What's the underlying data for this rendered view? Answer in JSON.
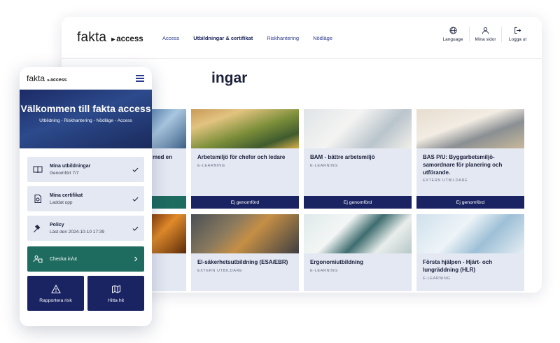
{
  "desktop": {
    "brand": {
      "name": "fakta",
      "product": "access"
    },
    "nav": [
      "Access",
      "Utbildningar & certifikat",
      "Riskhantering",
      "Nödläge"
    ],
    "tools": [
      {
        "label": "Language",
        "icon": "globe-icon"
      },
      {
        "label": "Mina sidor",
        "icon": "user-icon"
      },
      {
        "label": "Logga ut",
        "icon": "logout-icon"
      }
    ],
    "page_title": "ingar",
    "cards": [
      {
        "title": "med en",
        "type": "",
        "status": "",
        "image": "glass-building"
      },
      {
        "title": "Arbetsmiljö för chefer och ledare",
        "type": "E-LEARNING",
        "status": "Ej genomförd",
        "image": "construction-workers"
      },
      {
        "title": "BAM - bättre arbetsmiljö",
        "type": "E-LEARNING",
        "status": "Ej genomförd",
        "image": "office-desk"
      },
      {
        "title": "BAS P/U: Byggarbetsmiljö-samordnare för planering och utförande.",
        "type": "EXTERN UTBILDARE",
        "status": "Ej genomförd",
        "image": "building-site"
      },
      {
        "title": "",
        "type": "",
        "status": "",
        "image": "fire"
      },
      {
        "title": "El-säkerhetsutbildning (ESA/EBR)",
        "type": "EXTERN UTBILDARE",
        "status": "",
        "image": "electrician"
      },
      {
        "title": "Ergonomiutbildning",
        "type": "E-LEARNING",
        "status": "",
        "image": "ergonomic-office"
      },
      {
        "title": "Första hjälpen - Hjärt- och lungräddning (HLR)",
        "type": "E-LEARNING",
        "status": "",
        "image": "medic"
      }
    ]
  },
  "phone": {
    "brand": {
      "name": "fakta",
      "product": "access"
    },
    "hero_title": "Välkommen till fakta access",
    "hero_sub": "Utbildning - Riskhantering - Nödläge - Access",
    "items": [
      {
        "title": "Mina utbildningar",
        "sub": "Genomfört 7/7"
      },
      {
        "title": "Mina certifikat",
        "sub": "Laddat upp"
      },
      {
        "title": "Policy",
        "sub": "Läst den 2024-10-10 17:39"
      }
    ],
    "checkin": "Checka in/ut",
    "buttons": [
      "Rapportera risk",
      "Hitta hit"
    ]
  },
  "colors": {
    "navy": "#1a2462",
    "green": "#1e6b5f",
    "card_bg": "#e4e8f3"
  }
}
